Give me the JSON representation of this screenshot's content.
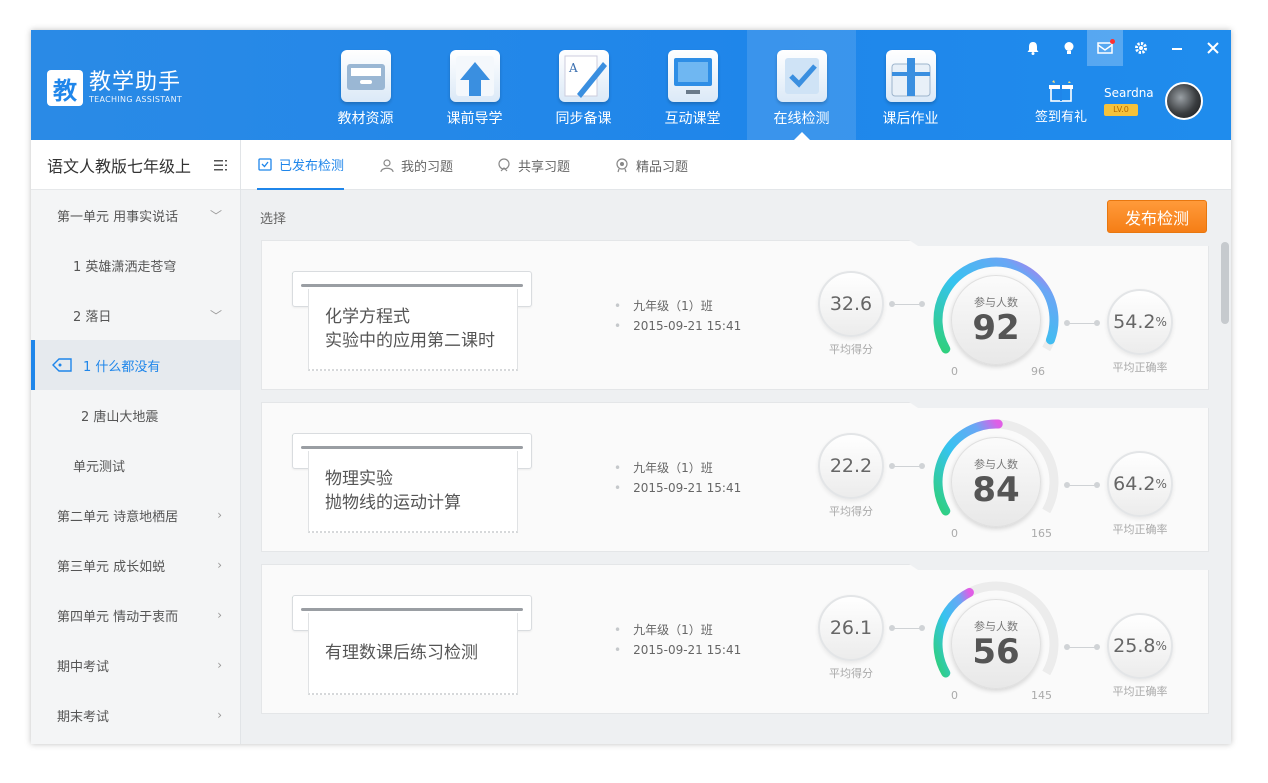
{
  "app": {
    "logo_char": "教",
    "logo_cn": "教学助手",
    "logo_en": "TEACHING ASSISTANT"
  },
  "nav": [
    {
      "label": "教材资源",
      "icon": "textbook-icon"
    },
    {
      "label": "课前导学",
      "icon": "upload-arrow-icon"
    },
    {
      "label": "同步备课",
      "icon": "pencil-icon"
    },
    {
      "label": "互动课堂",
      "icon": "monitor-icon"
    },
    {
      "label": "在线检测",
      "icon": "checkmark-clipboard-icon",
      "active": true
    },
    {
      "label": "课后作业",
      "icon": "briefcase-icon"
    }
  ],
  "toolbar": {
    "signin_label": "签到有礼",
    "username": "Seardna",
    "vip": "LV.0"
  },
  "sidebar": {
    "title": "语文人教版七年级上",
    "items": [
      {
        "label": "第一单元 用事实说话",
        "level": 1,
        "chevron": "﹀"
      },
      {
        "label": "1 英雄潇洒走苍穹",
        "level": 2
      },
      {
        "label": "2 落日",
        "level": 2,
        "chevron": "﹀"
      },
      {
        "label": "1 什么都没有",
        "level": 3,
        "active": true
      },
      {
        "label": "2 唐山大地震",
        "level": 3
      },
      {
        "label": "单元测试",
        "level": 2
      },
      {
        "label": "第二单元 诗意地栖居",
        "level": 1,
        "chevron": "›"
      },
      {
        "label": "第三单元 成长如蜕",
        "level": 1,
        "chevron": "›"
      },
      {
        "label": "第四单元 情动于衷而",
        "level": 1,
        "chevron": "›"
      },
      {
        "label": "期中考试",
        "level": 1,
        "chevron": "›"
      },
      {
        "label": "期末考试",
        "level": 1,
        "chevron": "›"
      }
    ]
  },
  "tabs": [
    {
      "label": "已发布检测",
      "active": true
    },
    {
      "label": "我的习题"
    },
    {
      "label": "共享习题"
    },
    {
      "label": "精品习题"
    }
  ],
  "main": {
    "select_label": "选择",
    "publish_button": "发布检测",
    "avg_score_label": "平均得分",
    "participants_label": "参与人数",
    "accuracy_label": "平均正确率",
    "percent_sign": "%",
    "min_label": "0"
  },
  "cards": [
    {
      "title_line1": "化学方程式",
      "title_line2": "实验中的应用第二课时",
      "class_name": "九年级（1）班",
      "datetime": "2015-09-21 15:41",
      "avg_score": "32.6",
      "participants": "92",
      "participants_value": 92,
      "total": "96",
      "total_value": 96,
      "accuracy": "54.2"
    },
    {
      "title_line1": "物理实验",
      "title_line2": "抛物线的运动计算",
      "class_name": "九年级（1）班",
      "datetime": "2015-09-21 15:41",
      "avg_score": "22.2",
      "participants": "84",
      "participants_value": 84,
      "total": "165",
      "total_value": 165,
      "accuracy": "64.2"
    },
    {
      "title_line1": "有理数课后练习检测",
      "title_line2": "",
      "class_name": "九年级（1）班",
      "datetime": "2015-09-21 15:41",
      "avg_score": "26.1",
      "participants": "56",
      "participants_value": 56,
      "total": "145",
      "total_value": 145,
      "accuracy": "25.8"
    }
  ],
  "colors": {
    "brand_blue": "#1f86ea",
    "publish_orange": "#f58a20",
    "strip_green": "#4cd28a",
    "strip_cyan": "#5ac8e8",
    "strip_magenta": "#e25be0"
  }
}
